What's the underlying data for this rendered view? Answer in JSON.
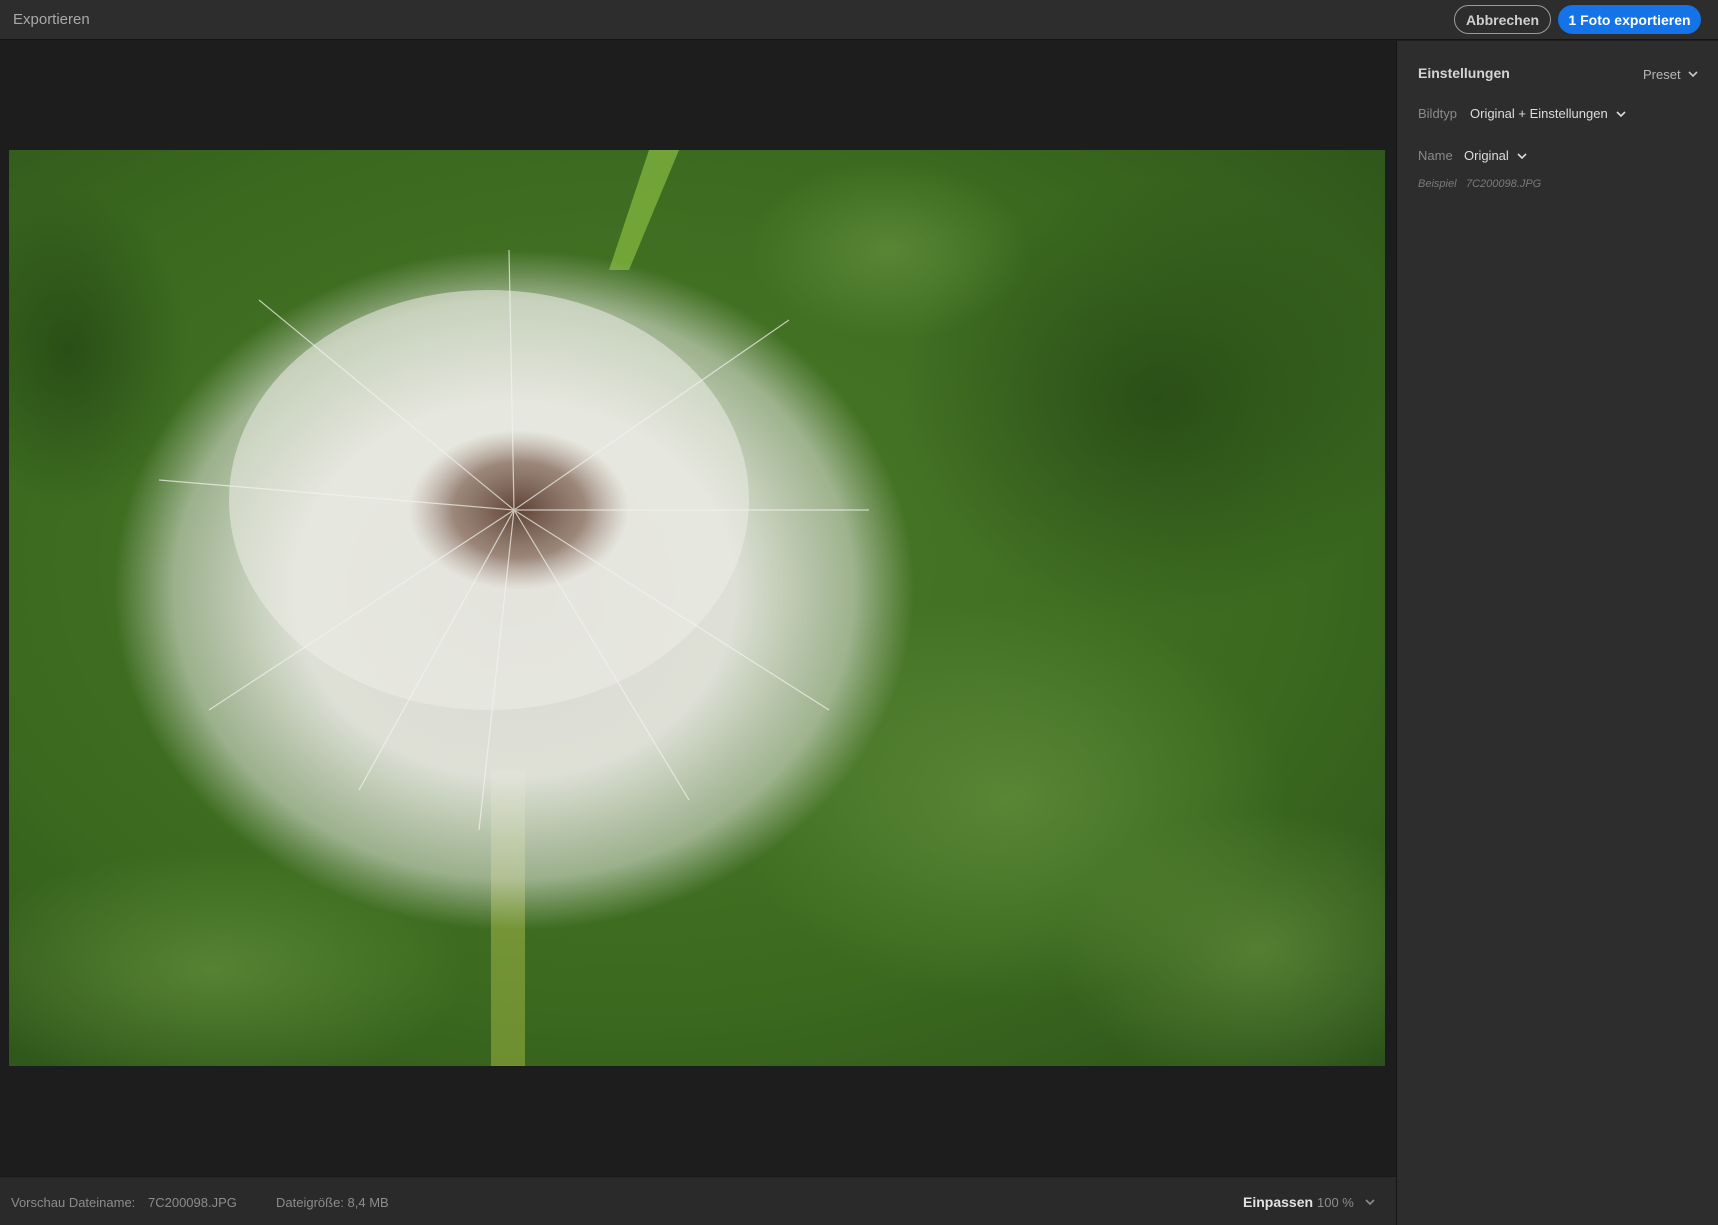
{
  "window": {
    "title": "Exportieren"
  },
  "header": {
    "cancel_label": "Abbrechen",
    "export_label": "1 Foto exportieren"
  },
  "footer": {
    "preview_filename_label": "Vorschau Dateiname:",
    "preview_filename_value": "7C200098.JPG",
    "filesize_label": "Dateigröße: 8,4 MB",
    "fit_label": "Einpassen",
    "zoom_value": "100 %"
  },
  "settings": {
    "title": "Einstellungen",
    "preset_label": "Preset",
    "image_type_label": "Bildtyp",
    "image_type_value": "Original + Einstellungen",
    "name_label": "Name",
    "name_value": "Original",
    "example_label": "Beispiel",
    "example_value": "7C200098.JPG"
  },
  "colors": {
    "accent": "#1473e6",
    "panel_bg": "#2d2d2d",
    "preview_bg": "#1d1d1d"
  },
  "icons": [
    "chevron-down-icon"
  ]
}
